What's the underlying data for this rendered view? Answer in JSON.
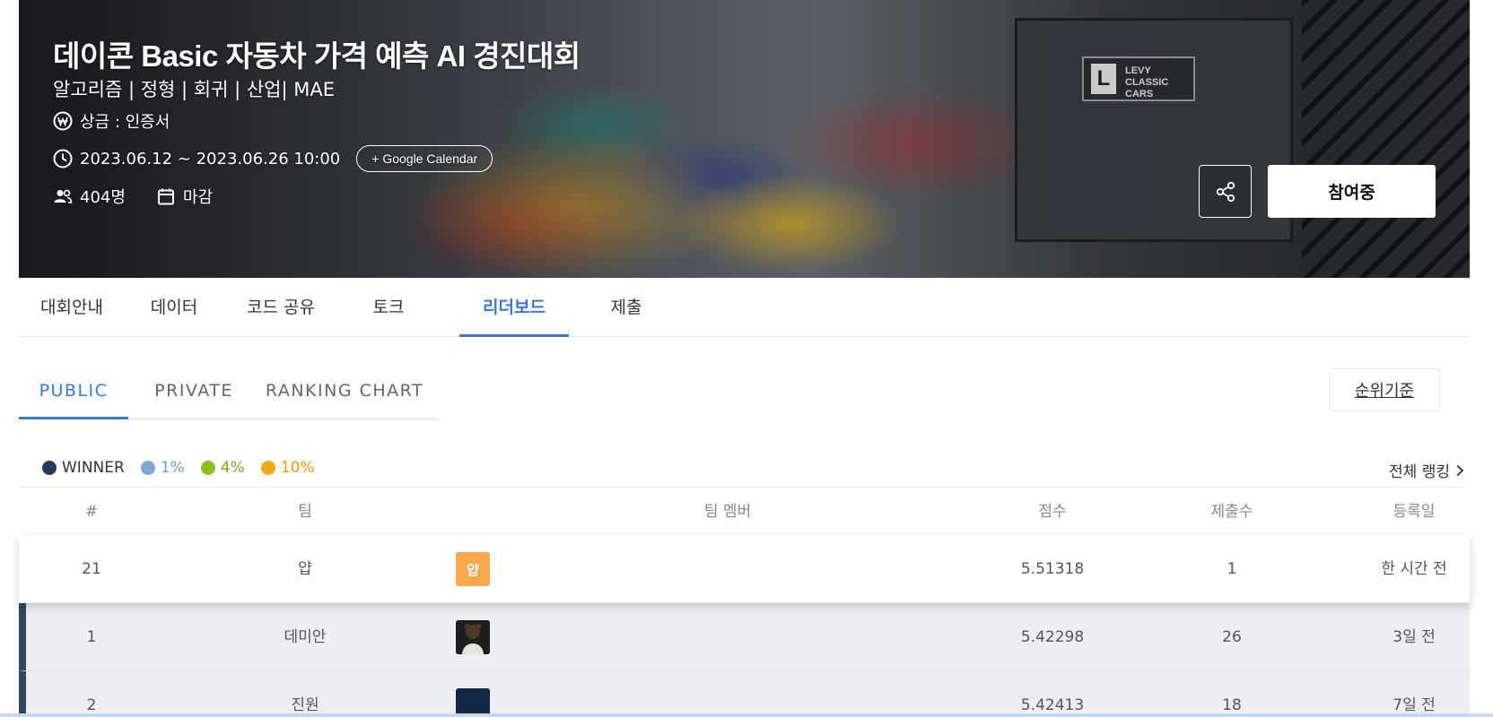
{
  "competition": {
    "title": "데이콘 Basic 자동차 가격 예측 AI 경진대회",
    "tags": "알고리즘 | 정형 | 회귀 | 산업| MAE",
    "prize": "상금 : 인증서",
    "period": "2023.06.12 ~ 2023.06.26 10:00",
    "calendar_button": "+ Google Calendar",
    "participants": "404명",
    "status": "마감",
    "join_button": "참여중",
    "showroom_sign": "LEVY\nCLASSIC CARS"
  },
  "main_tabs": [
    {
      "label": "대회안내"
    },
    {
      "label": "데이터"
    },
    {
      "label": "코드 공유"
    },
    {
      "label": "토크"
    },
    {
      "label": "리더보드",
      "active": true
    },
    {
      "label": "제출"
    }
  ],
  "sub_tabs": [
    {
      "label": "PUBLIC",
      "active": true
    },
    {
      "label": "PRIVATE"
    },
    {
      "label": "RANKING CHART"
    }
  ],
  "rank_criteria_button": "순위기준",
  "legend": [
    {
      "label": "WINNER",
      "color": "#233a5b",
      "text_color": "#333333"
    },
    {
      "label": "1%",
      "color": "#7fa9d4",
      "text_color": "#6a9ccc"
    },
    {
      "label": "4%",
      "color": "#8fbe1f",
      "text_color": "#7aa91a"
    },
    {
      "label": "10%",
      "color": "#f0a81c",
      "text_color": "#e39a10"
    }
  ],
  "full_ranking_link": "전체 랭킹",
  "table": {
    "headers": {
      "rank": "#",
      "team": "팀",
      "members": "팀 멤버",
      "score": "점수",
      "submissions": "제출수",
      "date": "등록일"
    },
    "rows": [
      {
        "rank": "21",
        "team": "얍",
        "avatar_text": "얍",
        "avatar_color": "#f7a84c",
        "score": "5.51318",
        "submissions": "1",
        "date": "한 시간 전",
        "kind": "mine"
      },
      {
        "rank": "1",
        "team": "데미안",
        "avatar_text": "",
        "avatar_color": "#2b2b2b",
        "score": "5.42298",
        "submissions": "26",
        "date": "3일 전",
        "kind": "winner"
      },
      {
        "rank": "2",
        "team": "진원",
        "avatar_text": "",
        "avatar_color": "#142846",
        "score": "5.42413",
        "submissions": "18",
        "date": "7일 전",
        "kind": "winner"
      }
    ]
  }
}
